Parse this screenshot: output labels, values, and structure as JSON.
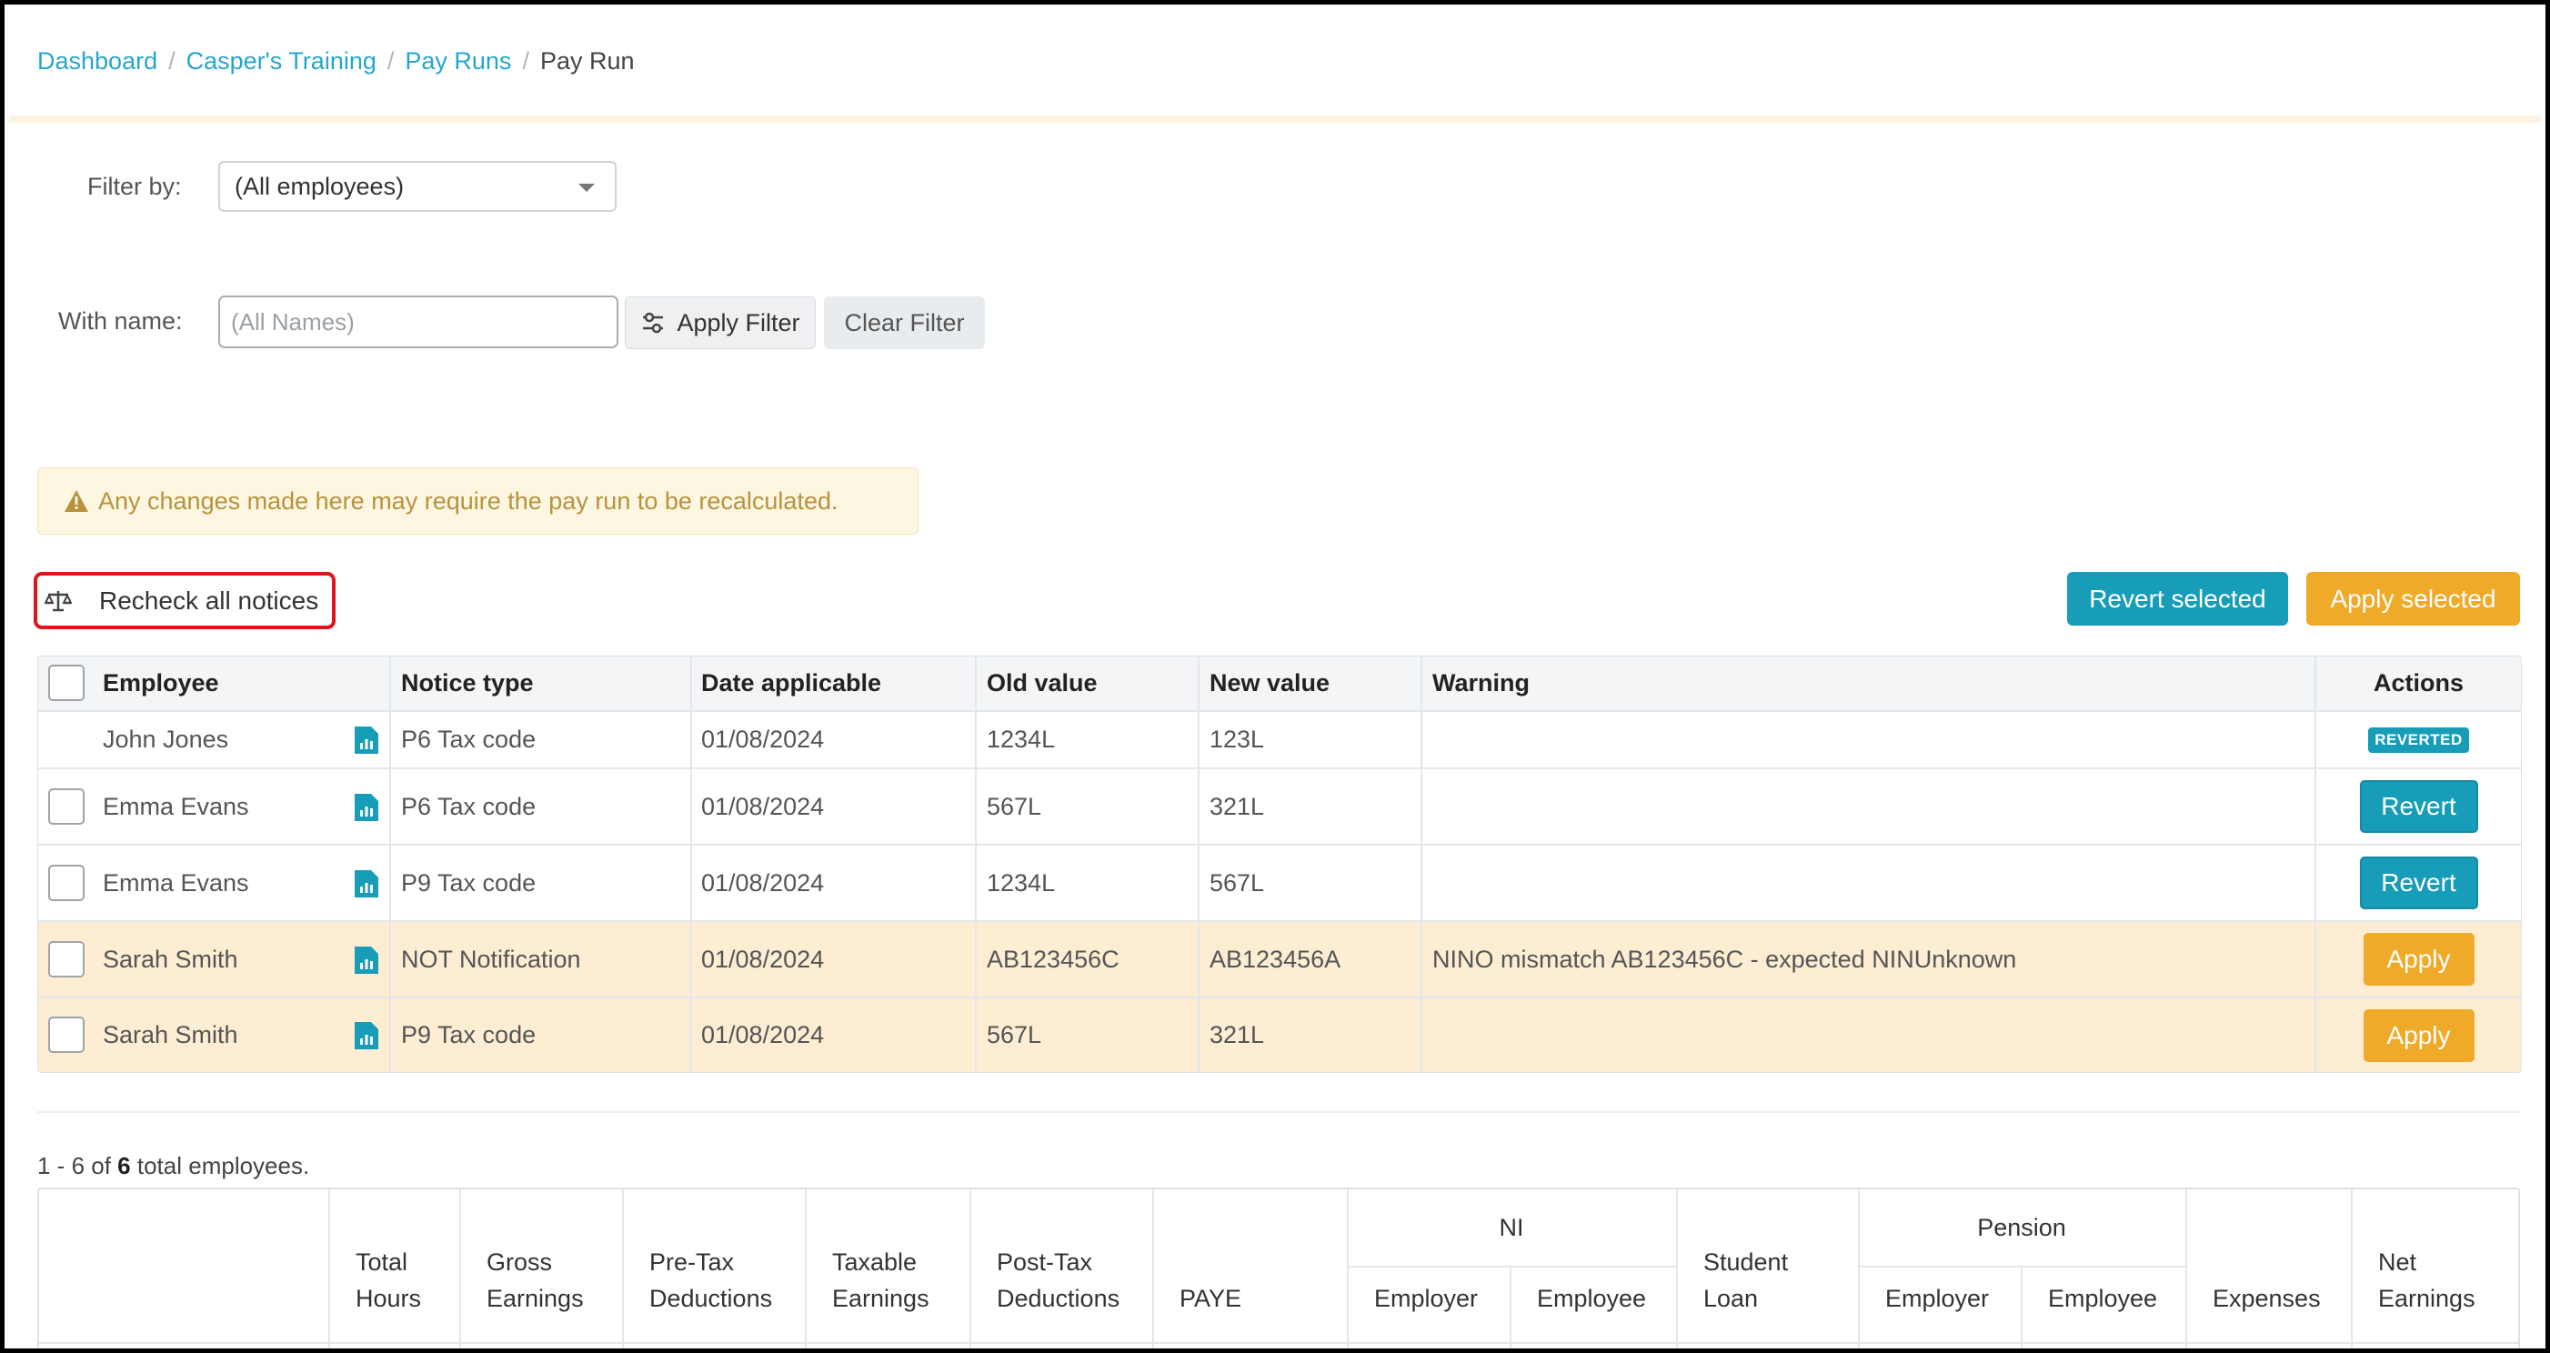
{
  "breadcrumb": {
    "items": [
      "Dashboard",
      "Casper's Training",
      "Pay Runs"
    ],
    "current": "Pay Run",
    "separator": "/"
  },
  "filter": {
    "filter_by_label": "Filter by:",
    "filter_by_value": "(All employees)",
    "with_name_label": "With name:",
    "name_placeholder": "(All Names)",
    "apply_filter": "Apply Filter",
    "clear_filter": "Clear Filter"
  },
  "alert": {
    "text": "Any changes made here may require the pay run to be recalculated."
  },
  "toolbar": {
    "recheck": "Recheck all notices",
    "revert_selected": "Revert selected",
    "apply_selected": "Apply selected"
  },
  "notices": {
    "headers": [
      "Employee",
      "Notice type",
      "Date applicable",
      "Old value",
      "New value",
      "Warning",
      "Actions"
    ],
    "rows": [
      {
        "employee": "John Jones",
        "type": "P6 Tax code",
        "date": "01/08/2024",
        "old": "1234L",
        "new": "123L",
        "warning": "",
        "action": "REVERTED",
        "checkbox": false,
        "highlight": false
      },
      {
        "employee": "Emma Evans",
        "type": "P6 Tax code",
        "date": "01/08/2024",
        "old": "567L",
        "new": "321L",
        "warning": "",
        "action": "Revert",
        "checkbox": true,
        "highlight": false
      },
      {
        "employee": "Emma Evans",
        "type": "P9 Tax code",
        "date": "01/08/2024",
        "old": "1234L",
        "new": "567L",
        "warning": "",
        "action": "Revert",
        "checkbox": true,
        "highlight": false
      },
      {
        "employee": "Sarah Smith",
        "type": "NOT Notification",
        "date": "01/08/2024",
        "old": "AB123456C",
        "new": "AB123456A",
        "warning": "NINO mismatch AB123456C - expected NINUnknown",
        "action": "Apply",
        "checkbox": true,
        "highlight": true
      },
      {
        "employee": "Sarah Smith",
        "type": "P9 Tax code",
        "date": "01/08/2024",
        "old": "567L",
        "new": "321L",
        "warning": "",
        "action": "Apply",
        "checkbox": true,
        "highlight": true
      }
    ]
  },
  "summary": {
    "count_prefix": "1 - 6 of",
    "count_total": "6",
    "count_suffix": "total employees.",
    "headers": {
      "total_hours": [
        "Total",
        "Hours"
      ],
      "gross": [
        "Gross",
        "Earnings"
      ],
      "pretax": [
        "Pre-Tax",
        "Deductions"
      ],
      "taxable": [
        "Taxable",
        "Earnings"
      ],
      "posttax": [
        "Post-Tax",
        "Deductions"
      ],
      "paye": "PAYE",
      "ni": "NI",
      "ni_employer": "Employer",
      "ni_employee": "Employee",
      "student_loan": [
        "Student",
        "Loan"
      ],
      "pension": "Pension",
      "pension_employer": "Employer",
      "pension_employee": "Employee",
      "expenses": "Expenses",
      "net": [
        "Net",
        "Earnings"
      ]
    }
  },
  "colors": {
    "link": "#26a6cc",
    "teal": "#189db9",
    "orange": "#efaa2a",
    "warn_row": "#fdedd3",
    "highlight_border": "#e0141e"
  }
}
